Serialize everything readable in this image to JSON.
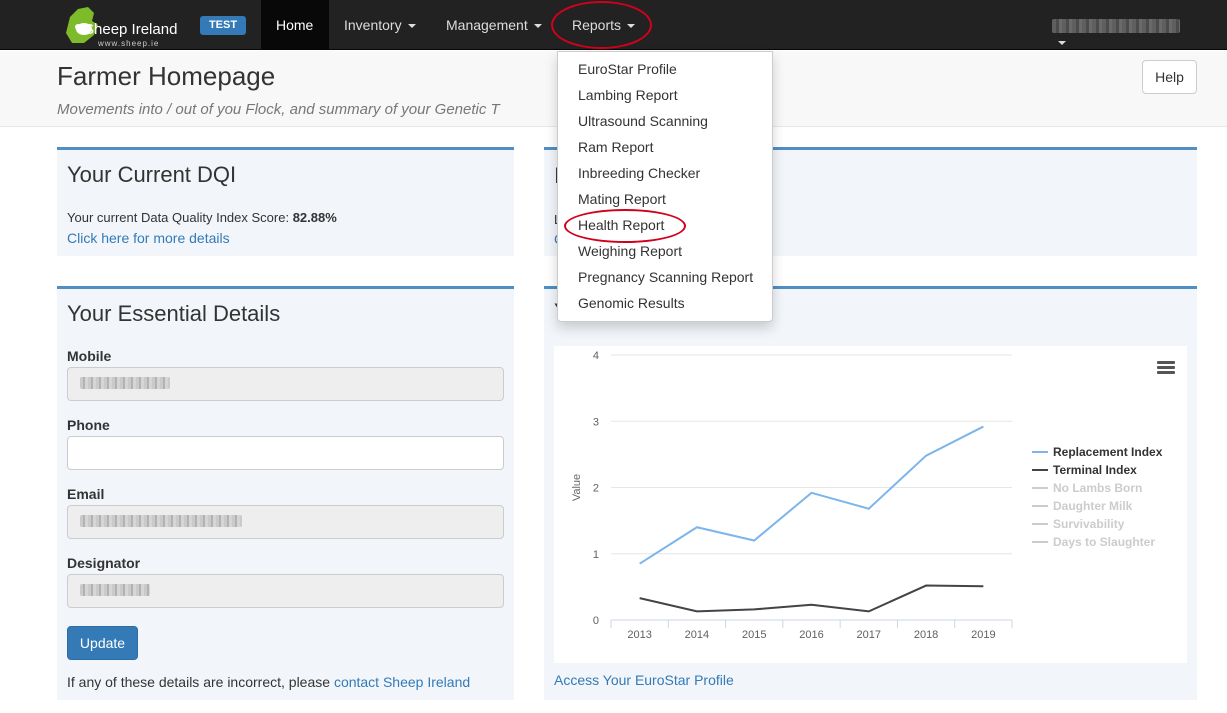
{
  "navbar": {
    "logo_text": "Sheep Ireland",
    "logo_sub": "www.sheep.ie",
    "env_badge": "TEST",
    "items": [
      {
        "label": "Home",
        "active": true
      },
      {
        "label": "Inventory",
        "dropdown": true
      },
      {
        "label": "Management",
        "dropdown": true
      },
      {
        "label": "Reports",
        "dropdown": true,
        "open": true
      }
    ]
  },
  "header": {
    "title": "Farmer Homepage",
    "subtitle": "Movements into / out of you Flock, and summary of your Genetic T",
    "help_label": "Help"
  },
  "reports_menu": {
    "items": [
      "EuroStar Profile",
      "Lambing Report",
      "Ultrasound Scanning",
      "Ram Report",
      "Inbreeding Checker",
      "Mating Report",
      "Health Report",
      "Weighing Report",
      "Pregnancy Scanning Report",
      "Genomic Results"
    ],
    "highlighted": "Health Report"
  },
  "dqi_panel": {
    "title": "Your Current DQI",
    "text": "Your current Data Quality Index Score: ",
    "score": "82.88%",
    "link": "Click here for more details"
  },
  "right_top_panel": {
    "title_fragment": "I",
    "line1_fragment": "L",
    "line2_fragment": "C"
  },
  "details_panel": {
    "title": "Your Essential Details",
    "fields": [
      {
        "label": "Mobile",
        "readonly": true
      },
      {
        "label": "Phone",
        "readonly": false
      },
      {
        "label": "Email",
        "readonly": true
      },
      {
        "label": "Designator",
        "readonly": true
      }
    ],
    "update_label": "Update",
    "incorrect_text": "If any of these details are incorrect, please ",
    "contact_link": "contact Sheep Ireland"
  },
  "chart_panel": {
    "title_fragment": "Y",
    "link": "Access Your EuroStar Profile"
  },
  "chart_data": {
    "type": "line",
    "categories": [
      "2013",
      "2014",
      "2015",
      "2016",
      "2017",
      "2018",
      "2019"
    ],
    "ylabel": "Value",
    "ylim": [
      0,
      4
    ],
    "yticks": [
      "0",
      "1",
      "2",
      "3",
      "4"
    ],
    "series": [
      {
        "name": "Replacement Index",
        "color": "#7cb5ec",
        "visible": true,
        "values": [
          0.85,
          1.4,
          1.2,
          1.92,
          1.68,
          2.48,
          2.92
        ]
      },
      {
        "name": "Terminal Index",
        "color": "#434348",
        "visible": true,
        "values": [
          0.33,
          0.13,
          0.16,
          0.23,
          0.13,
          0.52,
          0.51
        ]
      },
      {
        "name": "No Lambs Born",
        "color": "#cccccc",
        "visible": false,
        "values": []
      },
      {
        "name": "Daughter Milk",
        "color": "#cccccc",
        "visible": false,
        "values": []
      },
      {
        "name": "Survivability",
        "color": "#cccccc",
        "visible": false,
        "values": []
      },
      {
        "name": "Days to Slaughter",
        "color": "#cccccc",
        "visible": false,
        "values": []
      }
    ],
    "legend_position": "right"
  }
}
